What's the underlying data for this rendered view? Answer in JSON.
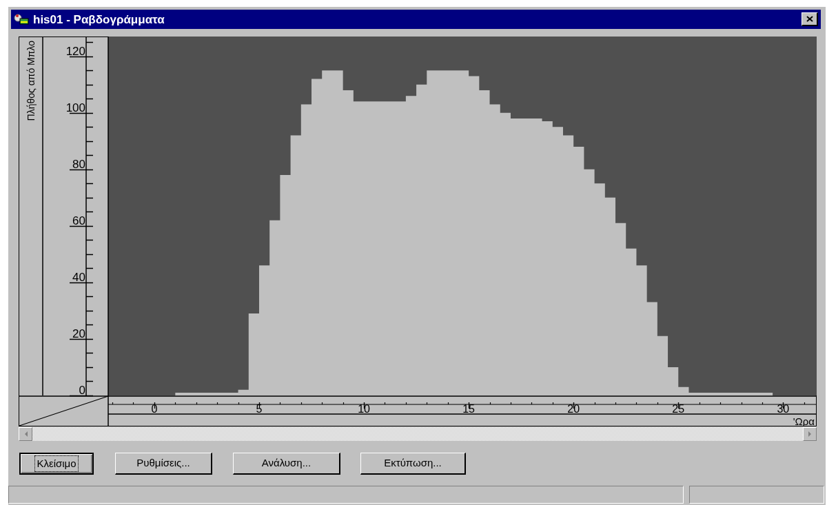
{
  "window": {
    "title": "his01 - Ραβδογράμματα"
  },
  "chart": {
    "chart_data": {
      "type": "area",
      "xlabel": "'Ωρα",
      "ylabel": "Πλήθος από Μπλο",
      "x": [
        0,
        0.5,
        1,
        1.5,
        2,
        2.5,
        3,
        3.5,
        4,
        4.5,
        5,
        5.5,
        6,
        6.5,
        7,
        7.5,
        8,
        8.5,
        9,
        9.5,
        10,
        10.5,
        11,
        11.5,
        12,
        12.5,
        13,
        13.5,
        14,
        14.5,
        15,
        15.5,
        16,
        16.5,
        17,
        17.5,
        18,
        18.5,
        19,
        19.5,
        20,
        20.5,
        21,
        21.5,
        22,
        22.5,
        23,
        23.5,
        24,
        24.5,
        25,
        25.5,
        26,
        26.5,
        27,
        27.5,
        28,
        28.5,
        29,
        29.5,
        30,
        30.5
      ],
      "values": [
        0,
        0,
        1,
        1,
        1,
        1,
        1,
        1,
        2,
        29,
        46,
        62,
        78,
        92,
        103,
        112,
        115,
        115,
        108,
        104,
        104,
        104,
        104,
        104,
        106,
        110,
        115,
        115,
        115,
        115,
        113,
        108,
        103,
        100,
        98,
        98,
        98,
        97,
        95,
        92,
        88,
        80,
        75,
        70,
        61,
        52,
        46,
        33,
        21,
        10,
        3,
        1,
        1,
        1,
        1,
        1,
        1,
        1,
        1,
        0,
        0,
        0
      ],
      "xlim": [
        -2.2,
        31.6
      ],
      "ylim": [
        0,
        127
      ],
      "xticks": [
        0,
        5,
        10,
        15,
        20,
        25,
        30
      ],
      "yticks": [
        0,
        20,
        40,
        60,
        80,
        100,
        120
      ]
    }
  },
  "buttons": [
    {
      "label": "Κλείσιμο",
      "focused": true
    },
    {
      "label": "Ρυθμίσεις...",
      "focused": false
    },
    {
      "label": "Ανάλυση...",
      "focused": false
    },
    {
      "label": "Εκτύπωση...",
      "focused": false
    }
  ]
}
